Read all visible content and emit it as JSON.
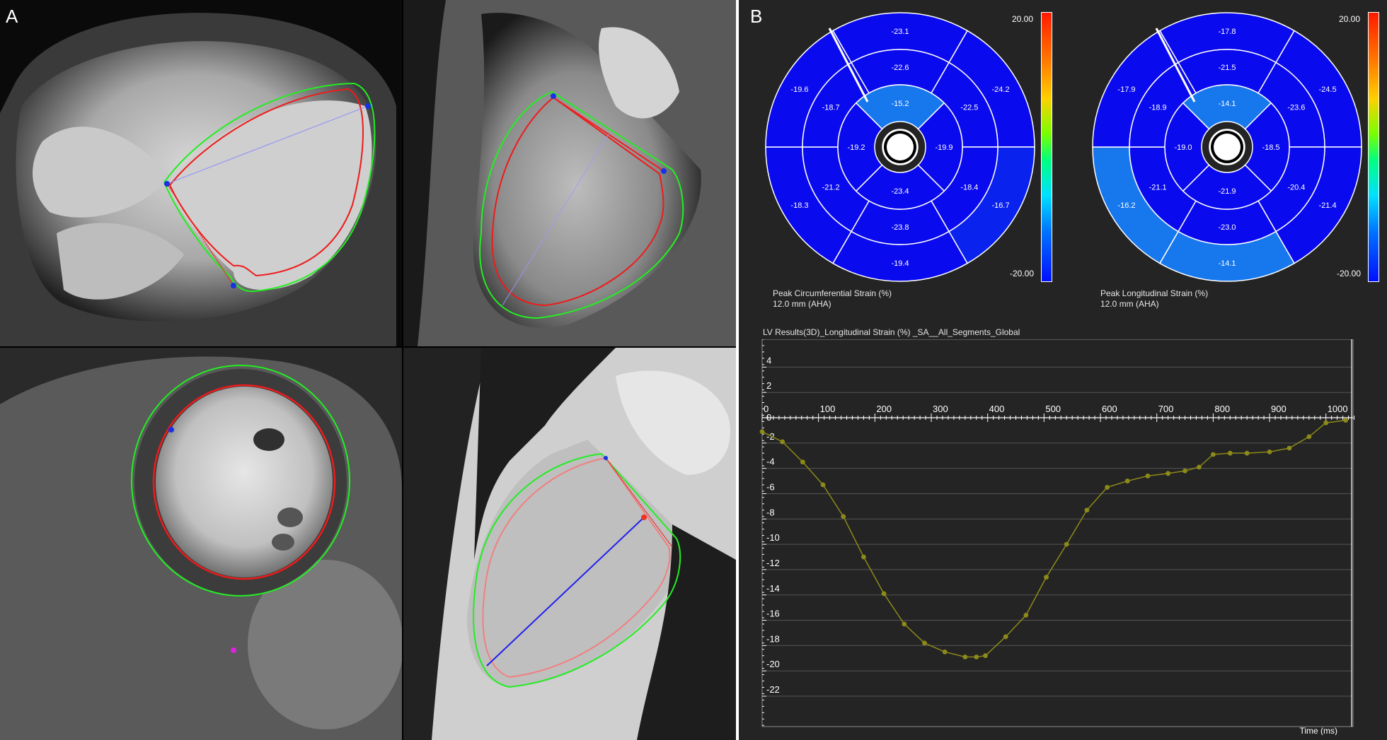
{
  "panel_a": {
    "label": "A"
  },
  "panel_b": {
    "label": "B",
    "circumferential": {
      "caption_line1": "Peak Circumferential Strain (%)",
      "caption_line2": "12.0 mm (AHA)",
      "scale_max": "20.00",
      "scale_min": "-20.00",
      "segments": {
        "basal": [
          "-23.1",
          "-24.2",
          "-16.7",
          "-19.4",
          "-18.3",
          "-19.6"
        ],
        "mid": [
          "-22.6",
          "-22.5",
          "-18.4",
          "-23.8",
          "-21.2",
          "-18.7"
        ],
        "apical": [
          "-15.2",
          "-19.9",
          "-23.4",
          "-19.2"
        ]
      }
    },
    "longitudinal": {
      "caption_line1": "Peak Longitudinal Strain (%)",
      "caption_line2": "12.0 mm (AHA)",
      "scale_max": "20.00",
      "scale_min": "-20.00",
      "segments": {
        "basal": [
          "-17.8",
          "-24.5",
          "-21.4",
          "-14.1",
          "-16.2",
          "-17.9"
        ],
        "mid": [
          "-21.5",
          "-23.6",
          "-20.4",
          "-23.0",
          "-21.1",
          "-18.9"
        ],
        "apical": [
          "-14.1",
          "-18.5",
          "-21.9",
          "-19.0"
        ]
      }
    },
    "colors": {
      "dark_segment": "#0a0aee",
      "light_segment": "#1778ee",
      "mid_segment": "#0a22ee",
      "line_color": "#8c8a19"
    }
  },
  "chart_data": {
    "type": "line",
    "title": "LV Results(3D)_Longitudinal Strain (%) _SA__All_Segments_Global",
    "xlabel": "Time (ms)",
    "ylabel": "",
    "xlim": [
      0,
      1050
    ],
    "ylim": [
      -24,
      6
    ],
    "x_ticks": [
      0,
      100,
      200,
      300,
      400,
      500,
      600,
      700,
      800,
      900,
      1000
    ],
    "y_ticks": [
      4,
      2,
      0,
      -2,
      -4,
      -6,
      -8,
      -10,
      -12,
      -14,
      -16,
      -18,
      -20,
      -22
    ],
    "grid": true,
    "series": [
      {
        "x": [
          0,
          36,
          72,
          108,
          144,
          180,
          216,
          252,
          288,
          324,
          360,
          380,
          396,
          432,
          468,
          504,
          540,
          576,
          612,
          648,
          684,
          720,
          750,
          775,
          800,
          830,
          860,
          900,
          935,
          970,
          1000,
          1035
        ],
        "y": [
          -1.1,
          -1.9,
          -3.5,
          -5.3,
          -7.8,
          -11.0,
          -13.9,
          -16.3,
          -17.8,
          -18.5,
          -18.9,
          -18.9,
          -18.8,
          -17.3,
          -15.6,
          -12.6,
          -10.0,
          -7.3,
          -5.5,
          -5.0,
          -4.6,
          -4.4,
          -4.2,
          -3.9,
          -2.9,
          -2.8,
          -2.8,
          -2.7,
          -2.4,
          -1.5,
          -0.4,
          -0.2
        ]
      }
    ]
  }
}
